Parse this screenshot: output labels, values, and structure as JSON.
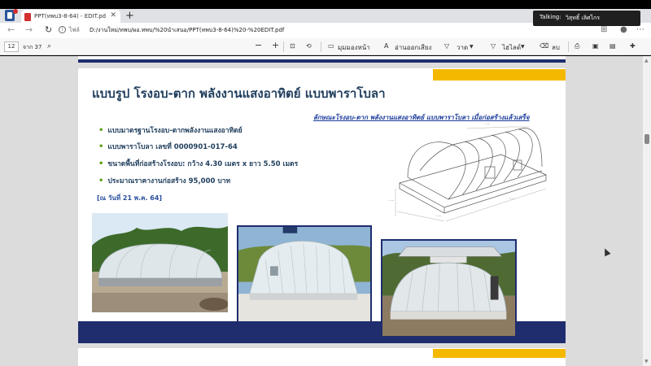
{
  "browser": {
    "tab_title": "PPT(ทพบ3-8-64) - EDIT.pdf",
    "tab_close": "✕",
    "new_tab": "+",
    "address_prefix": "ไฟล์",
    "url": "D:/งานใหม่/ทพบ/ผอ.ทพบ/%20นำเสนอ/PPT(ทพบ3-8-64)%20-%20EDIT.pdf"
  },
  "pdf_toolbar": {
    "page_number": "12",
    "page_total": "จาก 37",
    "zoom_out": "−",
    "zoom_in": "+",
    "page_view_label": "มุมมองหน้า",
    "read_aloud_label": "อ่านออกเสียง",
    "draw_label": "วาด",
    "highlight_label": "ไฮไลต์",
    "erase_label": "ลบ"
  },
  "talking_popup": {
    "label": "Talking:",
    "name": "วิสุทธิ์ เลิศไกร"
  },
  "slide": {
    "title": "แบบรูป โรงอบ-ตาก พลังงานแสงอาทิตย์ แบบพาราโบลา",
    "bullets": [
      "แบบมาตรฐานโรงอบ-ตากพลังงานแสงอาทิตย์",
      "แบบพาราโบลา เลขที่ 0000901-017-64",
      "ขนาดพื้นที่ก่อสร้างโรงอบ: กว้าง 4.30 เมตร x ยาว 5.50 เมตร",
      "ประมาณราคางานก่อสร้าง 95,000 บาท"
    ],
    "date_note": "[ณ วันที่ 21 พ.ค. 64]",
    "diagram_caption": "ลักษณะโรงอบ-ตาก พลังงานแสงอาทิตย์ แบบพาราโบลา เมื่อก่อสร้างแล้วเสร็จ"
  },
  "colors": {
    "navy": "#1f2d6e",
    "gold": "#f5b800",
    "title_text": "#1f3d5c",
    "bullet_green": "#5a9f1a"
  }
}
